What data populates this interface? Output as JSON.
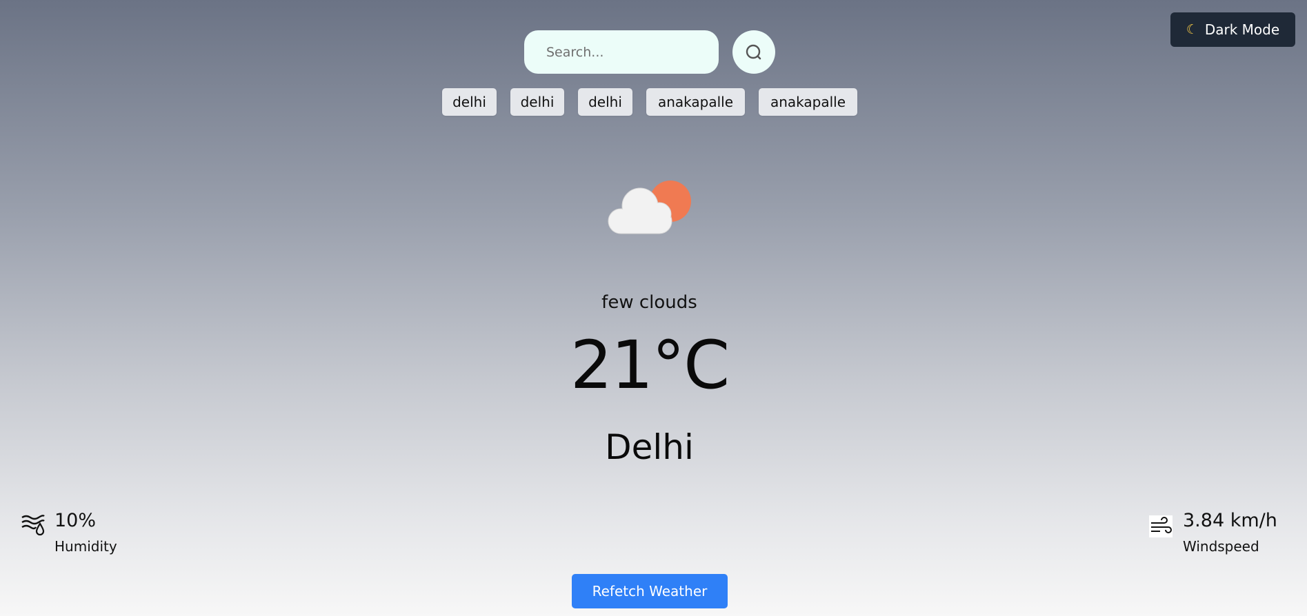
{
  "header": {
    "dark_mode_label": "Dark Mode",
    "dark_mode_icon": "moon-icon"
  },
  "search": {
    "placeholder": "Search...",
    "value": "",
    "button_icon": "search-icon"
  },
  "history": [
    "delhi",
    "delhi",
    "delhi",
    "anakapalle",
    "anakapalle"
  ],
  "weather": {
    "icon": "cloud-sun-icon",
    "description": "few clouds",
    "temperature": "21°C",
    "city": "Delhi"
  },
  "stats": {
    "humidity": {
      "icon": "humidity-icon",
      "value": "10%",
      "label": "Humidity"
    },
    "windspeed": {
      "icon": "wind-icon",
      "value": "3.84 km/h",
      "label": "Windspeed"
    }
  },
  "actions": {
    "refetch_label": "Refetch Weather"
  },
  "colors": {
    "primary_button": "#2f80f7",
    "dark_button": "#1f2937",
    "search_background": "#ecfdf9",
    "chip_background": "#e5e7eb",
    "sun": "#f07a52",
    "cloud": "#f2f2f2"
  }
}
